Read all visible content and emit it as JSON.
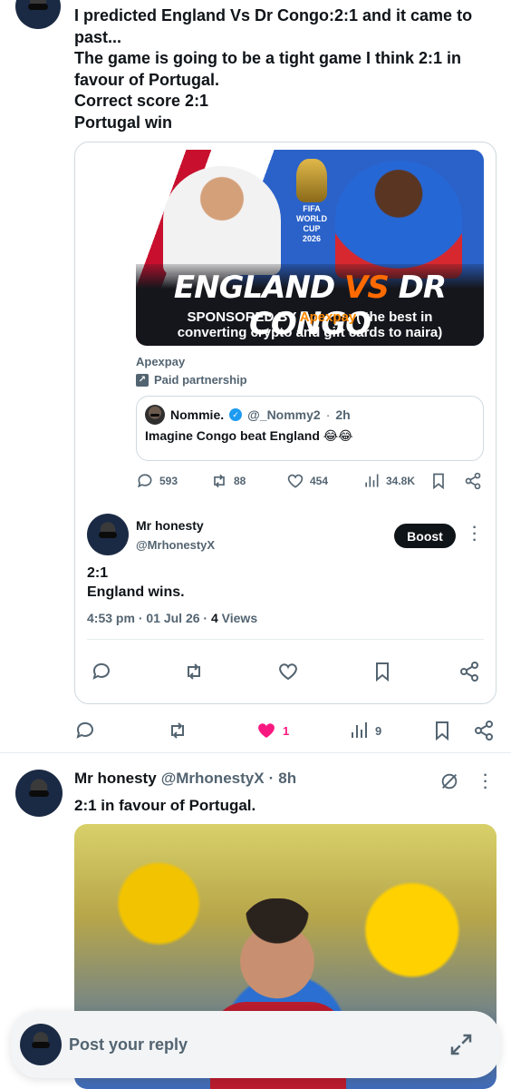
{
  "top_post": {
    "lines": [
      "I predicted England Vs Dr Congo:2:1 and it came to",
      "past...",
      "The game is going to be a tight game I think 2:1 in",
      "favour of Portugal.",
      "Correct score 2:1",
      "Portugal win"
    ]
  },
  "ad": {
    "image": {
      "team_left": "ENGLAND",
      "vs": "VS",
      "team_right": "DR CONGO",
      "badge_top": "FIFA",
      "badge_bottom": "WORLD CUP",
      "badge_year": "2026",
      "sponsored_prefix": "SPONSORED BY",
      "sponsor": "Apexpay",
      "sponsored_rest": "( the best in",
      "sponsored_line2": "converting crypto and gift cards to naira)"
    },
    "advertiser": "Apexpay",
    "paid_partnership": "Paid partnership",
    "quote": {
      "name": "Nommie.",
      "handle": "@_Nommy2",
      "time": "2h",
      "text": "Imagine Congo beat England 😂😂"
    },
    "actions": {
      "replies": "593",
      "reposts": "88",
      "likes": "454",
      "views": "34.8K"
    }
  },
  "inner_post": {
    "name": "Mr honesty",
    "handle": "@MrhonestyX",
    "boost_label": "Boost",
    "line1": "2:1",
    "line2": "England wins.",
    "time": "4:53 pm",
    "date": "01 Jul 26",
    "views_count": "4",
    "views_label": "Views"
  },
  "outer_actions": {
    "likes": "1",
    "views": "9"
  },
  "second_post": {
    "name": "Mr honesty",
    "handle": "@MrhonestyX",
    "time": "8h",
    "text": "2:1 in favour of Portugal."
  },
  "reply_bar": {
    "placeholder": "Post your reply"
  },
  "colors": {
    "like_active": "#f91880",
    "verified": "#1d9bf0",
    "sponsor": "#ff8a00"
  }
}
